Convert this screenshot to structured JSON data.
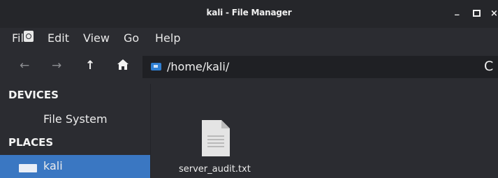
{
  "window": {
    "title": "kali - File Manager",
    "minimize_label": "_",
    "close_label": "×"
  },
  "menu": {
    "items": [
      "File",
      "Edit",
      "View",
      "Go",
      "Help"
    ]
  },
  "toolbar": {
    "back_label": "←",
    "forward_label": "→",
    "up_label": "↑",
    "path": "/home/kali/",
    "reload_label": "C"
  },
  "sidebar": {
    "devices_header": "DEVICES",
    "places_header": "PLACES",
    "devices": [
      {
        "label": "File System",
        "icon": "drive-icon"
      }
    ],
    "places": [
      {
        "label": "kali",
        "icon": "folder-icon",
        "selected": true
      }
    ]
  },
  "files": [
    {
      "name": "server_audit.txt",
      "icon": "text-file-icon"
    }
  ],
  "colors": {
    "selection": "#3a77c2",
    "background": "#2b2c31",
    "titlebar": "#25262a"
  }
}
